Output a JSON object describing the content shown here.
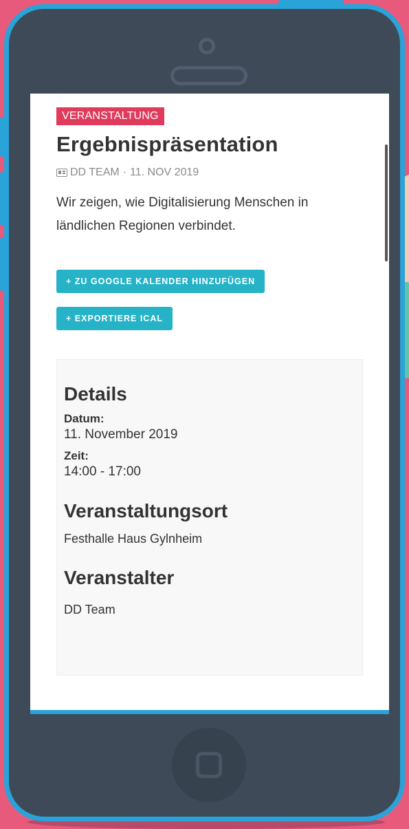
{
  "event": {
    "category": "VERANSTALTUNG",
    "title": "Ergebnispräsentation",
    "organizer_meta": "DD TEAM",
    "date_meta": "11. NOV 2019",
    "meta_separator": "·",
    "description": "Wir zeigen, wie Digitalisierung Menschen in ländlichen Regionen verbindet."
  },
  "actions": {
    "google_calendar": "+ ZU GOOGLE KALENDER HINZUFÜGEN",
    "export_ical": "+ EXPORTIERE ICAL"
  },
  "details": {
    "heading": "Details",
    "date_label": "Datum:",
    "date_value": "11. November 2019",
    "time_label": "Zeit:",
    "time_value": "14:00 - 17:00",
    "venue_heading": "Veranstaltungsort",
    "venue_value": "Festhalle Haus Gylnheim",
    "organizer_heading": "Veranstalter",
    "organizer_value": "DD Team"
  },
  "colors": {
    "category_badge": "#e03b5c",
    "button": "#26b3c8",
    "phone_frame": "#2aa3d9",
    "phone_body": "#3e4a58",
    "background": "#e85a7c"
  },
  "icons": {
    "meta_icon": "contact-card-icon"
  }
}
